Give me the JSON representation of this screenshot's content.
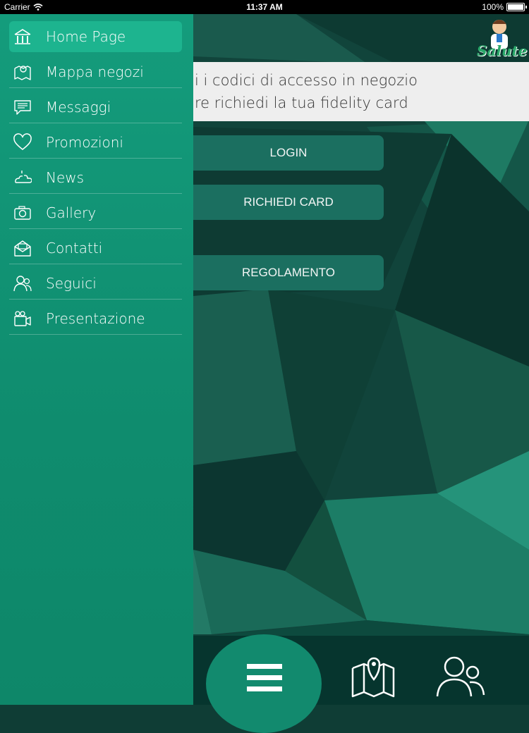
{
  "status_bar": {
    "carrier": "Carrier",
    "time": "11:37 AM",
    "battery": "100%"
  },
  "logo": {
    "text": "Salute"
  },
  "info": {
    "line1": "i i codici di accesso in negozio",
    "line2": "re richiedi la tua fidelity card"
  },
  "buttons": {
    "login": "LOGIN",
    "card": "RICHIEDI CARD",
    "rules": "REGOLAMENTO"
  },
  "sidebar": {
    "items": [
      {
        "label": "Home Page",
        "icon": "home-icon"
      },
      {
        "label": "Mappa negozi",
        "icon": "map-icon"
      },
      {
        "label": "Messaggi",
        "icon": "message-icon"
      },
      {
        "label": "Promozioni",
        "icon": "heart-icon"
      },
      {
        "label": "News",
        "icon": "news-icon"
      },
      {
        "label": "Gallery",
        "icon": "camera-icon"
      },
      {
        "label": "Contatti",
        "icon": "contact-icon"
      },
      {
        "label": "Seguici",
        "icon": "users-icon"
      },
      {
        "label": "Presentazione",
        "icon": "video-icon"
      }
    ]
  },
  "colors": {
    "sidebar": "#129476",
    "active": "#1db48f",
    "button": "#1c7263",
    "banner": "#eeeeee"
  }
}
